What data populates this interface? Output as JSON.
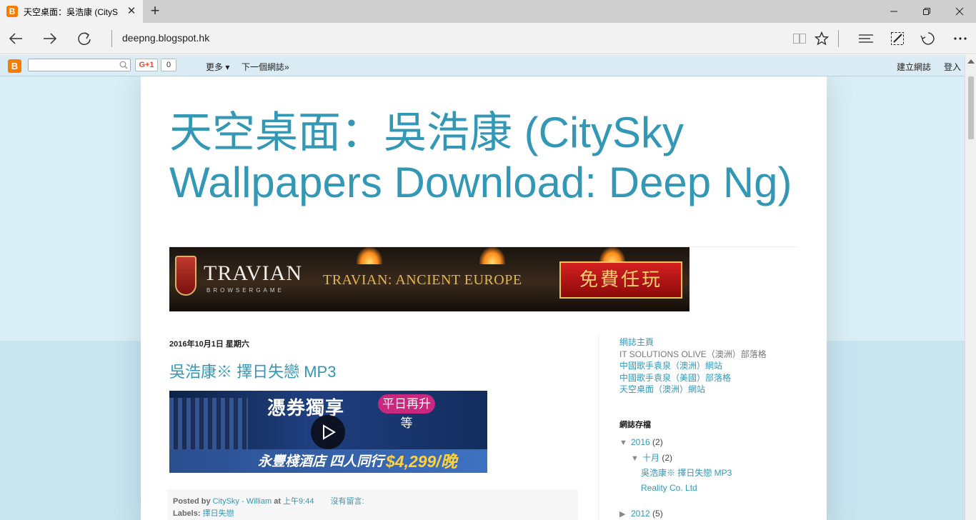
{
  "browser": {
    "tab_title": "天空桌面：吳浩康 (CityS",
    "tab_favicon": "B",
    "url": "deepng.blogspot.hk",
    "icons": {
      "back": "arrow-left-icon",
      "forward": "arrow-right-icon",
      "refresh": "refresh-icon",
      "reading_view": "book-icon",
      "favorite": "star-icon",
      "hub": "hub-icon",
      "web_note": "pen-icon",
      "share": "share-icon",
      "more": "more-icon"
    }
  },
  "blogger_bar": {
    "logo": "B",
    "search_value": "",
    "gplus_label": "G+1",
    "gplus_count": "0",
    "more_label": "更多 ▾",
    "next_blog_label": "下一個網誌»",
    "create_blog_label": "建立網誌",
    "sign_in_label": "登入"
  },
  "blog": {
    "title": "天空桌面：吳浩康 (CitySky Wallpapers Download: Deep Ng)"
  },
  "banner": {
    "logo": "TRAVIAN",
    "sub": "BROWSERGAME",
    "tagline": "TRAVIAN: ANCIENT EUROPE",
    "cta": "免費任玩"
  },
  "post": {
    "date": "2016年10月1日 星期六",
    "title": "吳浩康※ 擇日失戀 MP3",
    "ad": {
      "headline": "憑券獨享",
      "pill": "平日再升等",
      "footer": "永豐棧酒店 四人同行",
      "price": "$4,299/晚"
    },
    "footer": {
      "posted_by_label": "Posted by",
      "author": "CitySky - William",
      "at_label": "at",
      "time": "上午9:44",
      "comments": "沒有留言:",
      "labels_label": "Labels:",
      "label": "擇日失戀"
    }
  },
  "sidebar": {
    "links": [
      {
        "text": "網誌主頁",
        "style": "link"
      },
      {
        "text": "IT SOLUTIONS OLIVE（澳洲）部落格",
        "style": "gray"
      },
      {
        "text": "中國歌手袁泉（澳洲）網站",
        "style": "link"
      },
      {
        "text": "中國歌手袁泉（美國）部落格",
        "style": "link"
      },
      {
        "text": "天空桌面（澳洲）網站",
        "style": "link"
      }
    ],
    "archive_title": "網誌存檔",
    "archive": {
      "y2016": {
        "year": "2016",
        "count": "(2)"
      },
      "oct": {
        "month": "十月",
        "count": "(2)"
      },
      "posts": [
        "吳浩康※ 擇日失戀 MP3",
        "Reality Co. Ltd"
      ],
      "y2012": {
        "year": "2012",
        "count": "(5)"
      }
    }
  },
  "colors": {
    "accent": "#3397b6",
    "page_background": "#c7e4ef",
    "blogger_orange": "#f57d00"
  }
}
